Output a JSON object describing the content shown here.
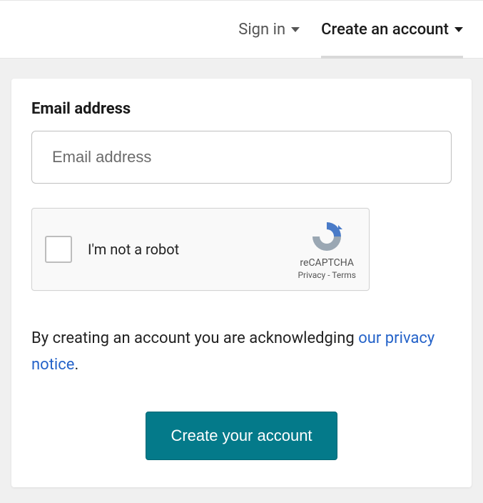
{
  "tabs": {
    "sign_in": "Sign in",
    "create_account": "Create an account"
  },
  "form": {
    "email_label": "Email address",
    "email_placeholder": "Email address"
  },
  "recaptcha": {
    "label": "I'm not a robot",
    "brand": "reCAPTCHA",
    "privacy": "Privacy",
    "terms": "Terms"
  },
  "disclaimer": {
    "prefix": "By creating an account you are acknowledging ",
    "link": "our privacy notice",
    "suffix": "."
  },
  "submit_label": "Create your account"
}
